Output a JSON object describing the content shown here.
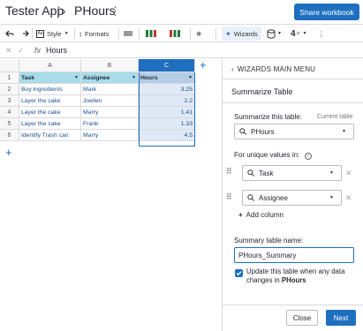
{
  "header": {
    "app_title": "Tester App",
    "page_name": "PHours",
    "share_label": "Share workbook"
  },
  "toolbar": {
    "style_label": "Style",
    "formats_label": "Formats",
    "wizards_label": "Wizards"
  },
  "formula_bar": {
    "fx_label": "fx",
    "value": "Hours"
  },
  "grid": {
    "columns": [
      "A",
      "B",
      "C"
    ],
    "row_numbers": [
      "1",
      "2",
      "3",
      "4",
      "5",
      "6"
    ],
    "headers": [
      "Task",
      "Assignee",
      "Hours"
    ],
    "rows": [
      [
        "Buy ingredients",
        "Mark",
        "3.25"
      ],
      [
        "Layer the cake",
        "Joellen",
        "2.2"
      ],
      [
        "Layer the cake",
        "Marry",
        "1.41"
      ],
      [
        "Layer the cake",
        "Frank",
        "1.33"
      ],
      [
        "Identify Trash can",
        "Marry",
        "4.5"
      ]
    ]
  },
  "panel": {
    "back_label": "WIZARDS MAIN MENU",
    "title": "Summarize Table",
    "summarize_label": "Summarize this table:",
    "current_table_label": "Current table",
    "table_select": "PHours",
    "unique_label": "For unique values in:",
    "unique_fields": [
      "Task",
      "Assignee"
    ],
    "add_column_label": "Add column",
    "summary_name_label": "Summary table name:",
    "summary_name_value": "PHours_Summary",
    "update_text": "Update this table when any data changes in",
    "update_table": "PHours",
    "close_label": "Close",
    "next_label": "Next"
  },
  "colors": {
    "accent": "#1e6fbf",
    "header_fill": "#a8dce8",
    "selected_column_fill": "#dfe9f7"
  }
}
